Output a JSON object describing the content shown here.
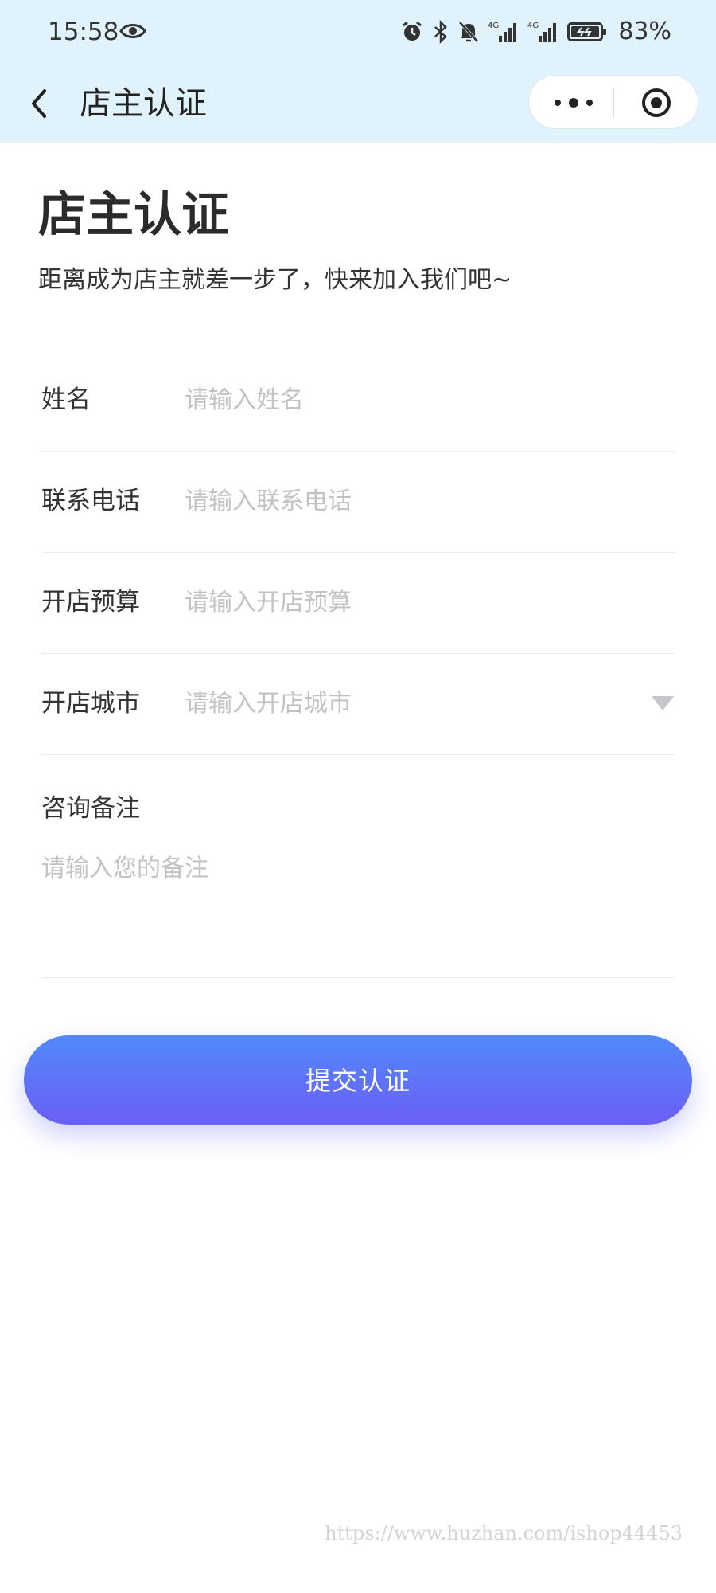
{
  "status_bar": {
    "time": "15:58",
    "battery": "83%",
    "icons": [
      "eye-icon",
      "alarm-icon",
      "bluetooth-icon",
      "mute-icon",
      "signal-4g-icon",
      "signal-4g-icon",
      "battery-icon"
    ]
  },
  "nav": {
    "title": "店主认证",
    "icons": [
      "back-icon",
      "more-icon",
      "close-target-icon"
    ]
  },
  "header": {
    "title": "店主认证",
    "subtitle": "距离成为店主就差一步了，快来加入我们吧~"
  },
  "form": {
    "name": {
      "label": "姓名",
      "placeholder": "请输入姓名"
    },
    "phone": {
      "label": "联系电话",
      "placeholder": "请输入联系电话"
    },
    "budget": {
      "label": "开店预算",
      "placeholder": "请输入开店预算"
    },
    "city": {
      "label": "开店城市",
      "placeholder": "请输入开店城市"
    },
    "remark": {
      "label": "咨询备注",
      "placeholder": "请输入您的备注"
    }
  },
  "submit_label": "提交认证",
  "watermark": "https://www.huzhan.com/ishop44453",
  "colors": {
    "top_background": "#e0f3fd",
    "button_gradient_start": "#5289f9",
    "button_gradient_end": "#6b5ff6",
    "placeholder": "#c2c2c2",
    "divider": "#ececec"
  }
}
